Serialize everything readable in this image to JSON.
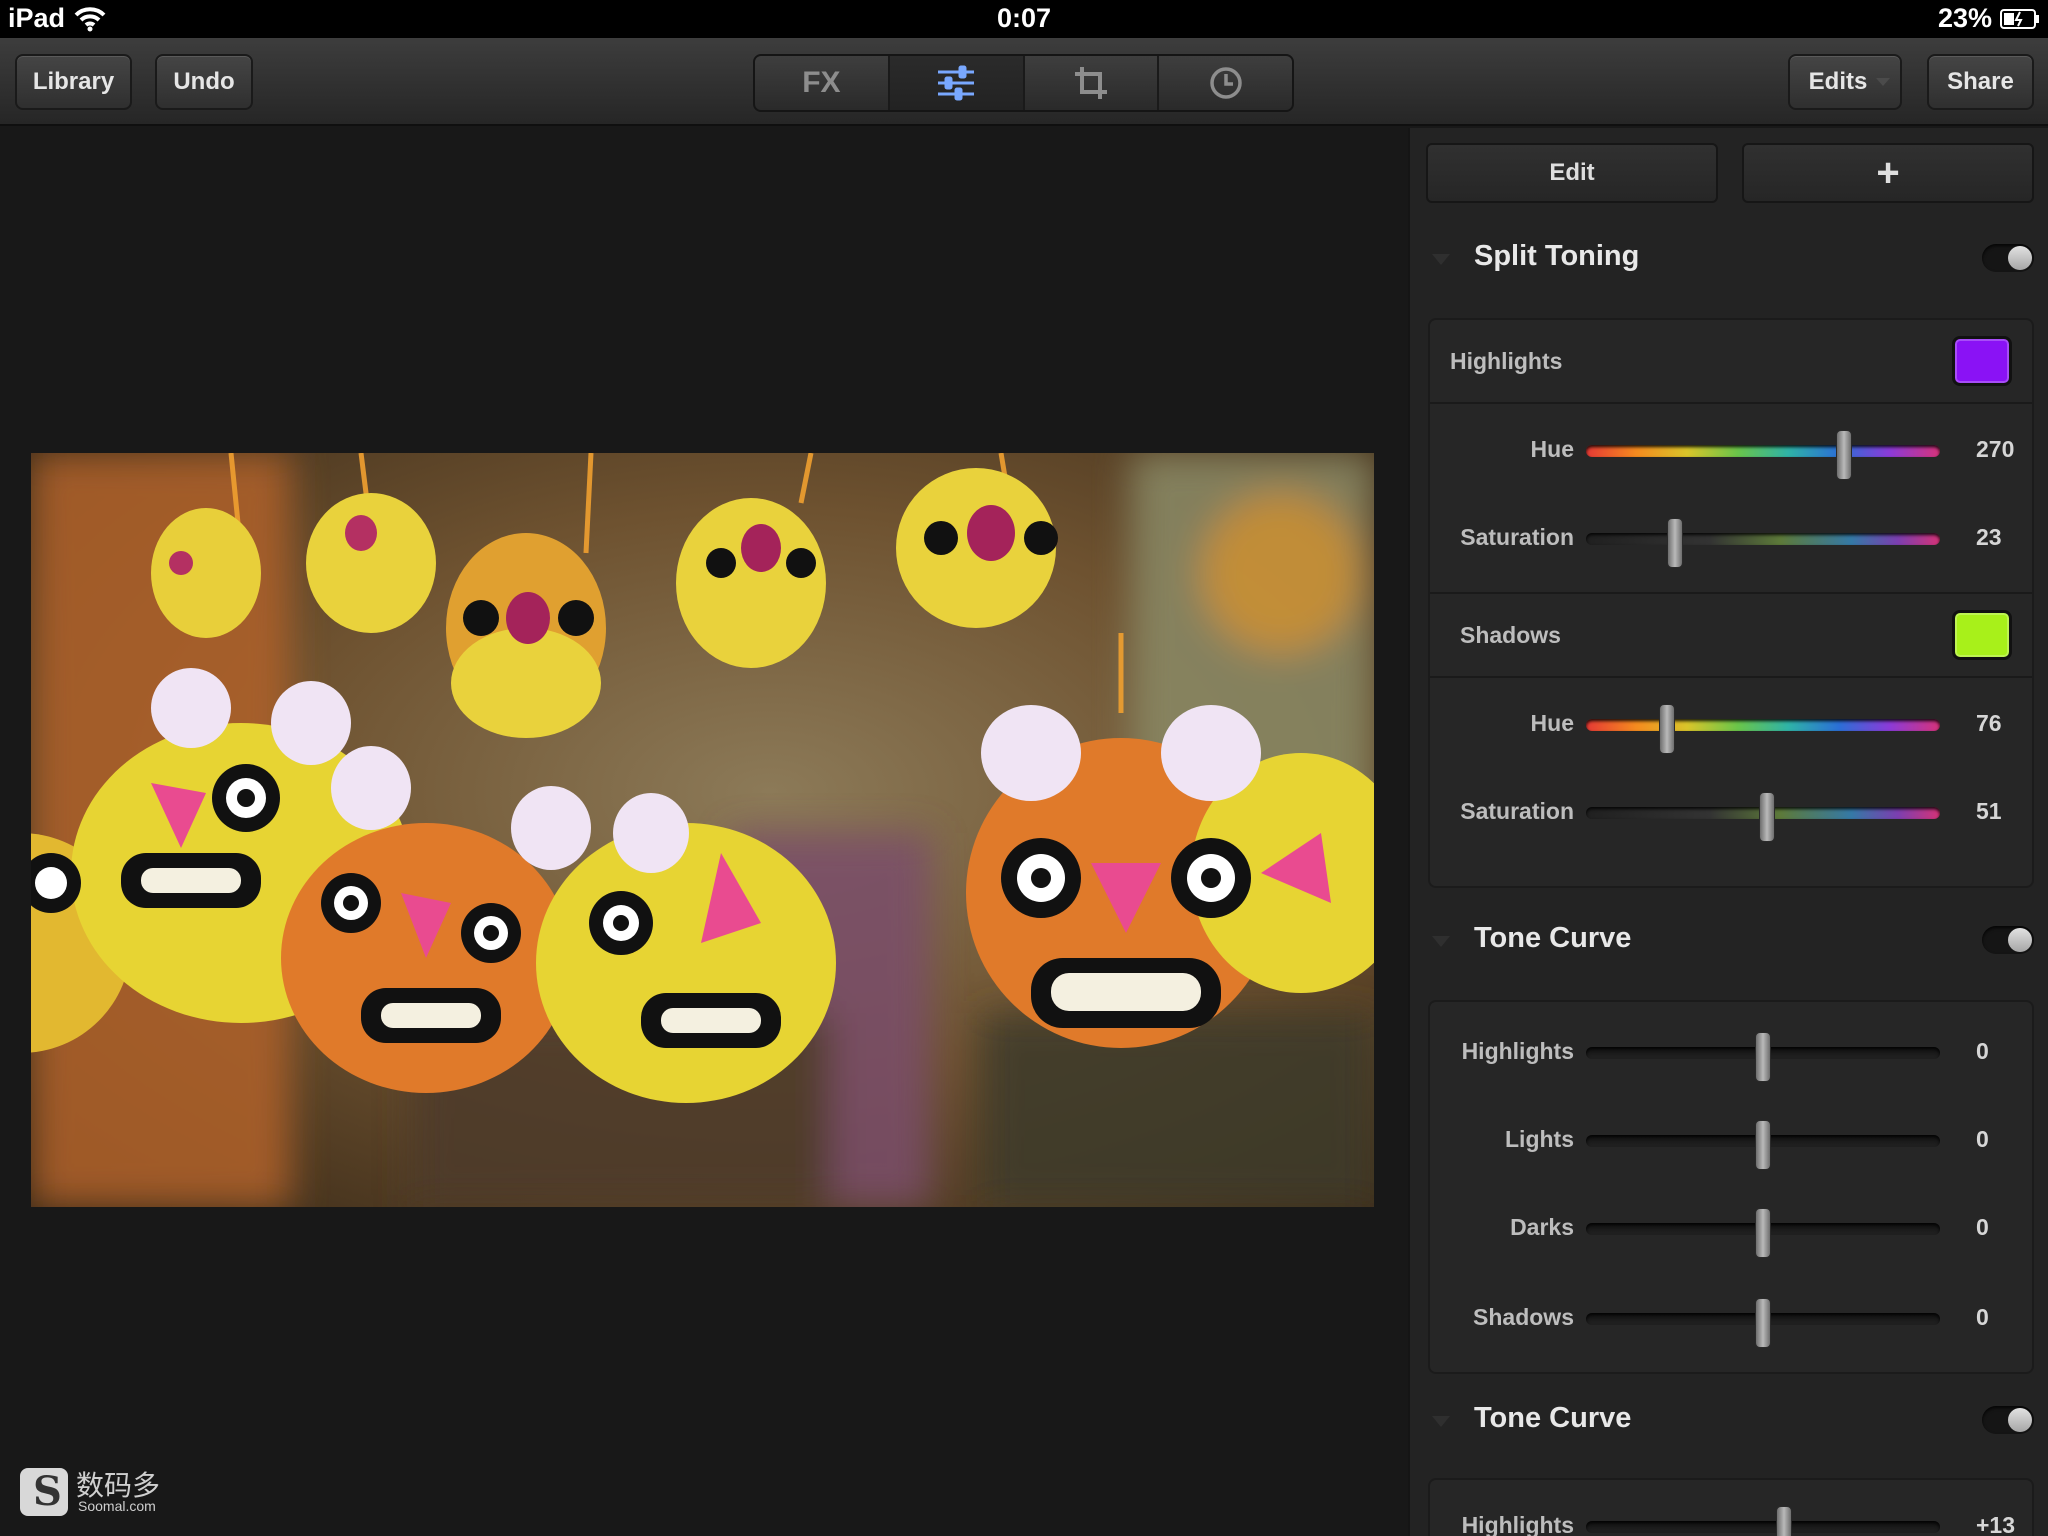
{
  "status_bar": {
    "device": "iPad",
    "time": "0:07",
    "battery": "23%"
  },
  "toolbar": {
    "library_label": "Library",
    "undo_label": "Undo",
    "fx_label": "FX",
    "edits_label": "Edits",
    "share_label": "Share",
    "active_tab": "adjust",
    "active_color": "#79a8ff"
  },
  "panel": {
    "edit_label": "Edit",
    "add_label": "+",
    "split_toning": {
      "title": "Split Toning",
      "enabled": true,
      "highlights": {
        "label": "Highlights",
        "color": "#8a12f5",
        "hue_label": "Hue",
        "hue_value": "270",
        "hue_fraction": 0.73,
        "saturation_label": "Saturation",
        "saturation_value": "23",
        "saturation_fraction": 0.25
      },
      "shadows": {
        "label": "Shadows",
        "color": "#a8f01a",
        "hue_label": "Hue",
        "hue_value": "76",
        "hue_fraction": 0.23,
        "saturation_label": "Saturation",
        "saturation_value": "51",
        "saturation_fraction": 0.51
      }
    },
    "tone_curve": {
      "title": "Tone Curve",
      "enabled": true,
      "rows": [
        {
          "label": "Highlights",
          "value": "0",
          "fraction": 0.5
        },
        {
          "label": "Lights",
          "value": "0",
          "fraction": 0.5
        },
        {
          "label": "Darks",
          "value": "0",
          "fraction": 0.5
        },
        {
          "label": "Shadows",
          "value": "0",
          "fraction": 0.5
        }
      ]
    },
    "tone_curve_2": {
      "title": "Tone Curve",
      "enabled": true,
      "first_row": {
        "label": "Highlights",
        "value": "+13",
        "fraction": 0.56
      }
    }
  },
  "watermark": {
    "text_cn": "数码多",
    "text_en": "Soomal.com"
  }
}
